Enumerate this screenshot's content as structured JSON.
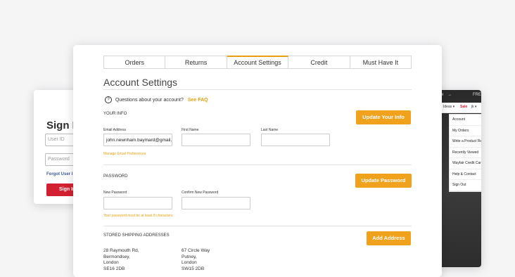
{
  "signin": {
    "title": "Sign In",
    "user_id_placeholder": "User ID",
    "password_placeholder": "Password",
    "forgot_label": "Forgot User I",
    "signin_button": "Sign In"
  },
  "account_dropdown": {
    "topbar_left": "w",
    "topbar_arrow": "→",
    "topbar_right": "FRE",
    "nav_ideas": "Ideas ▾",
    "nav_sale": "Sale",
    "nav_user": "jk ▾",
    "items": [
      "Account",
      "My Orders",
      "Write a Product Review",
      "Recently Viewed",
      "Wayfair Credit Card",
      "Help & Contact",
      "Sign Out"
    ]
  },
  "tabs": [
    "Orders",
    "Returns",
    "Account Settings",
    "Credit",
    "Must Have It"
  ],
  "active_tab": 2,
  "main": {
    "title": "Account Settings",
    "faq_question": "Questions about your account?",
    "faq_link": "See FAQ",
    "your_info": {
      "heading": "YOUR INFO",
      "button": "Update Your Info",
      "email_label": "Email Address",
      "email_value": "john.newnham.baymard@gmail.com",
      "first_name_label": "First Name",
      "first_name_value": "",
      "last_name_label": "Last Name",
      "last_name_value": "",
      "manage_email_link": "Manage Email Preferences"
    },
    "password": {
      "heading": "PASSWORD",
      "button": "Update Password",
      "new_label": "New Password",
      "confirm_label": "Confirm New Password",
      "hint": "Your password must be at least 8 characters"
    },
    "shipping": {
      "heading": "STORED SHIPPING ADDRESSES",
      "button": "Add Address",
      "addresses": [
        {
          "lines": "28 Raymouth Rd,\nBermondsey,\nLondon\nSE16 2DB"
        },
        {
          "lines": "67 Circle Way\nPutney,\nLondon\nSW15 2DB"
        }
      ]
    }
  },
  "colors": {
    "accent": "#f0a21c",
    "signin_red": "#d32030",
    "link_blue": "#3a5a9a",
    "background": "#f5f5f6"
  }
}
